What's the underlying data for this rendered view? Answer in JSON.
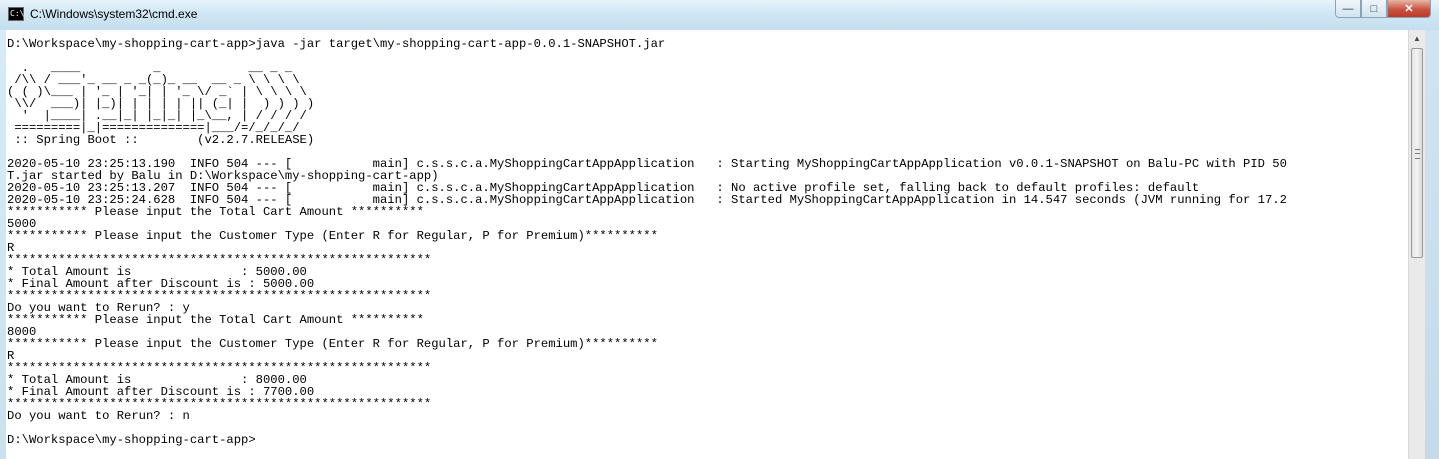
{
  "window": {
    "title": "C:\\Windows\\system32\\cmd.exe",
    "icon": "cmd-icon",
    "icon_text": "C:\\",
    "buttons": {
      "minimize": "—",
      "maximize": "□",
      "close": "✕"
    }
  },
  "console": {
    "lines": [
      "D:\\Workspace\\my-shopping-cart-app>java -jar target\\my-shopping-cart-app-0.0.1-SNAPSHOT.jar",
      "",
      "  .   ____          _            __ _ _",
      " /\\\\ / ___'_ __ _ _(_)_ __  __ _ \\ \\ \\ \\",
      "( ( )\\___ | '_ | '_| | '_ \\/ _` | \\ \\ \\ \\",
      " \\\\/  ___)| |_)| | | | | || (_| |  ) ) ) )",
      "  '  |____| .__|_| |_|_| |_\\__, | / / / /",
      " =========|_|==============|___/=/_/_/_/",
      " :: Spring Boot ::        (v2.2.7.RELEASE)",
      "",
      "2020-05-10 23:25:13.190  INFO 504 --- [           main] c.s.s.c.a.MyShoppingCartAppApplication   : Starting MyShoppingCartAppApplication v0.0.1-SNAPSHOT on Balu-PC with PID 50",
      "T.jar started by Balu in D:\\Workspace\\my-shopping-cart-app)",
      "2020-05-10 23:25:13.207  INFO 504 --- [           main] c.s.s.c.a.MyShoppingCartAppApplication   : No active profile set, falling back to default profiles: default",
      "2020-05-10 23:25:24.628  INFO 504 --- [           main] c.s.s.c.a.MyShoppingCartAppApplication   : Started MyShoppingCartAppApplication in 14.547 seconds (JVM running for 17.2",
      "*********** Please input the Total Cart Amount **********",
      "5000",
      "*********** Please input the Customer Type (Enter R for Regular, P for Premium)**********",
      "R",
      "**********************************************************",
      "* Total Amount is               : 5000.00",
      "* Final Amount after Discount is : 5000.00",
      "**********************************************************",
      "Do you want to Rerun? : y",
      "*********** Please input the Total Cart Amount **********",
      "8000",
      "*********** Please input the Customer Type (Enter R for Regular, P for Premium)**********",
      "R",
      "**********************************************************",
      "* Total Amount is               : 8000.00",
      "* Final Amount after Discount is : 7700.00",
      "**********************************************************",
      "Do you want to Rerun? : n",
      "",
      "D:\\Workspace\\my-shopping-cart-app>"
    ]
  },
  "scrollbar": {
    "up_arrow": "▲"
  }
}
